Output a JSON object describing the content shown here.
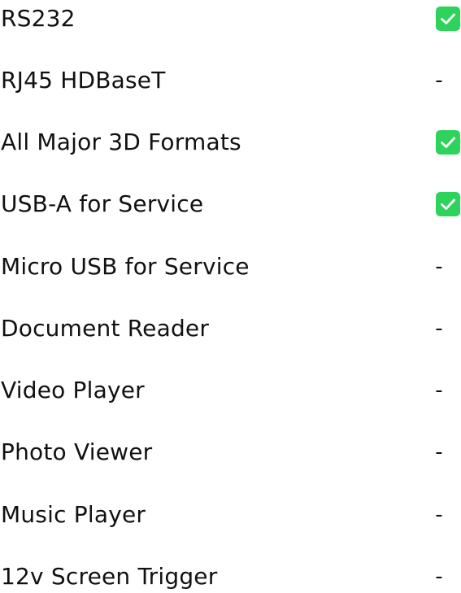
{
  "colors": {
    "check_fill": "#2ED35B",
    "check_mark": "#ffffff",
    "text": "#111111"
  },
  "features": [
    {
      "label": "RS232",
      "status": "check",
      "icon": "check-icon"
    },
    {
      "label": "RJ45 HDBaseT",
      "status": "dash",
      "mark": "-"
    },
    {
      "label": "All Major 3D Formats",
      "status": "check",
      "icon": "check-icon"
    },
    {
      "label": "USB-A for Service",
      "status": "check",
      "icon": "check-icon"
    },
    {
      "label": "Micro USB for Service",
      "status": "dash",
      "mark": "-"
    },
    {
      "label": "Document Reader",
      "status": "dash",
      "mark": "-"
    },
    {
      "label": "Video Player",
      "status": "dash",
      "mark": "-"
    },
    {
      "label": "Photo Viewer",
      "status": "dash",
      "mark": "-"
    },
    {
      "label": "Music Player",
      "status": "dash",
      "mark": "-"
    },
    {
      "label": "12v Screen Trigger",
      "status": "dash",
      "mark": "-"
    }
  ]
}
